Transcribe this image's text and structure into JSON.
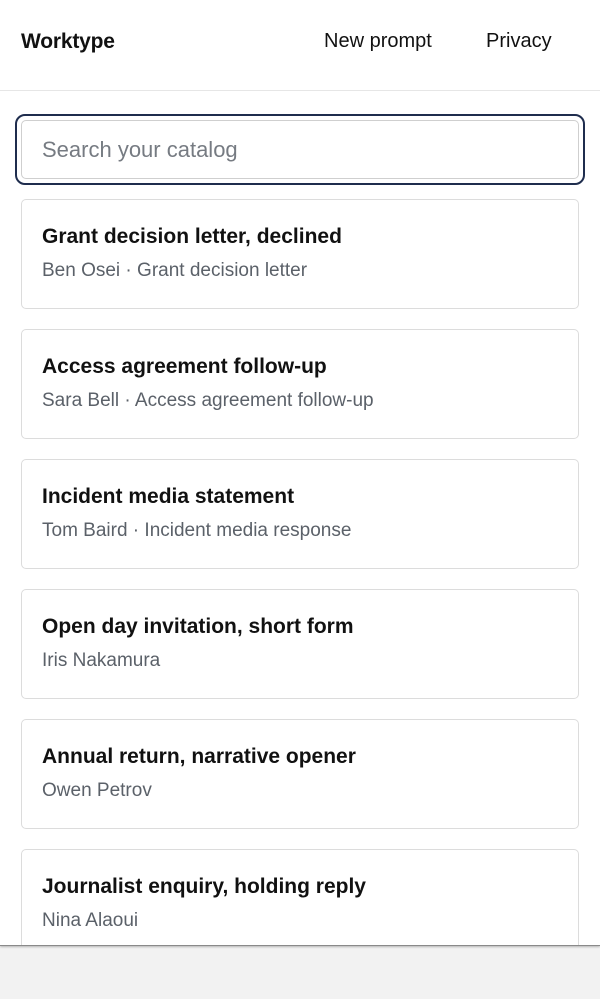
{
  "header": {
    "brand": "Worktype",
    "nav": {
      "new_prompt": "New prompt",
      "privacy": "Privacy"
    }
  },
  "search": {
    "placeholder": "Search your catalog",
    "value": ""
  },
  "items": [
    {
      "title": "Grant decision letter, declined",
      "meta": "Ben Osei · Grant decision letter"
    },
    {
      "title": "Access agreement follow-up",
      "meta": "Sara Bell · Access agreement follow-up"
    },
    {
      "title": "Incident media statement",
      "meta": "Tom Baird · Incident media response"
    },
    {
      "title": "Open day invitation, short form",
      "meta": "Iris Nakamura"
    },
    {
      "title": "Annual return, narrative opener",
      "meta": "Owen Petrov"
    },
    {
      "title": "Journalist enquiry, holding reply",
      "meta": "Nina Alaoui"
    }
  ],
  "colors": {
    "focus_ring": "#1f2d4e",
    "meta_text": "#5b6169",
    "card_border": "#dcdcdc"
  }
}
